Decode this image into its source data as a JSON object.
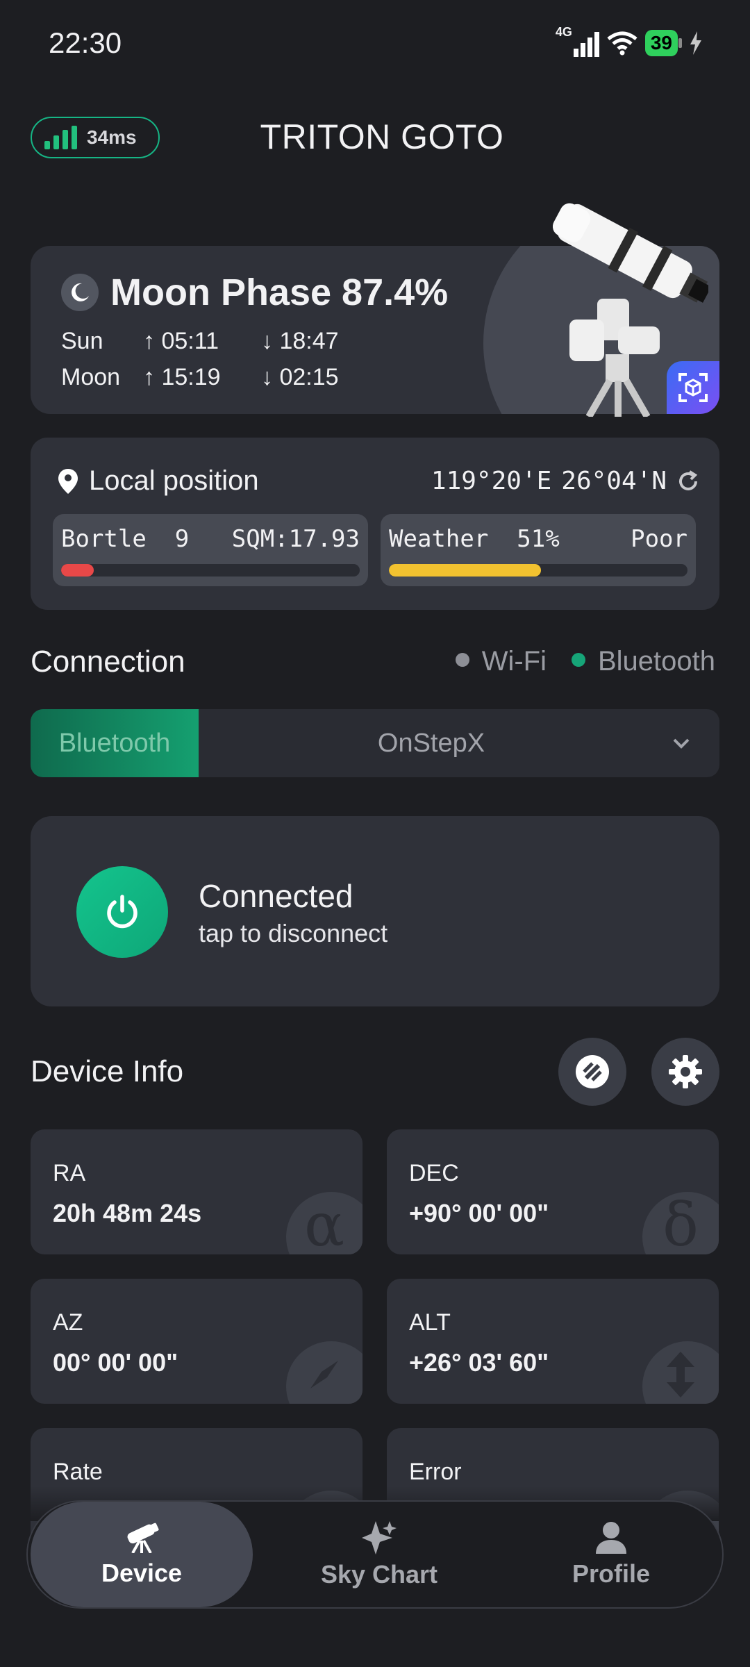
{
  "status_bar": {
    "time": "22:30",
    "network": "4G",
    "battery": "39"
  },
  "header": {
    "latency": "34ms",
    "title": "TRITON GOTO"
  },
  "moon_card": {
    "title": "Moon Phase 87.4%",
    "sun_label": "Sun",
    "sun_rise": "↑ 05:11",
    "sun_set": "↓ 18:47",
    "moon_label": "Moon",
    "moon_rise": "↑ 15:19",
    "moon_set": "↓ 02:15"
  },
  "position_card": {
    "title": "Local position",
    "longitude": "119°20'E",
    "latitude": "26°04'N",
    "bortle_label": "Bortle",
    "bortle_value": "9",
    "sqm": "SQM:17.93",
    "bortle_level": 0.11,
    "weather_label": "Weather",
    "weather_value": "51%",
    "weather_quality": "Poor",
    "weather_level": 0.51
  },
  "connection": {
    "title": "Connection",
    "types": [
      "Wi-Fi",
      "Bluetooth"
    ],
    "mode": "Bluetooth",
    "device": "OnStepX",
    "status": "Connected",
    "hint": "tap to disconnect"
  },
  "device_info": {
    "title": "Device Info",
    "cards": [
      {
        "label": "RA",
        "value": "20h 48m 24s",
        "glyph": "α"
      },
      {
        "label": "DEC",
        "value": "+90° 00' 00\"",
        "glyph": "δ"
      },
      {
        "label": "AZ",
        "value": "00° 00' 00\"",
        "glyph": "compass-icon"
      },
      {
        "label": "ALT",
        "value": "+26° 03' 60\"",
        "glyph": "vertical-arrows-icon"
      },
      {
        "label": "Rate",
        "value": "",
        "glyph": "gauge-icon"
      },
      {
        "label": "Error",
        "value": "",
        "glyph": "check-icon"
      }
    ]
  },
  "bottom_nav": {
    "items": [
      "Device",
      "Sky Chart",
      "Profile"
    ],
    "active": "Device"
  },
  "colors": {
    "accent_green": "#16b585",
    "bortle_bar": "#e84848",
    "weather_bar": "#f2c230",
    "card_bg": "#2f3139"
  }
}
